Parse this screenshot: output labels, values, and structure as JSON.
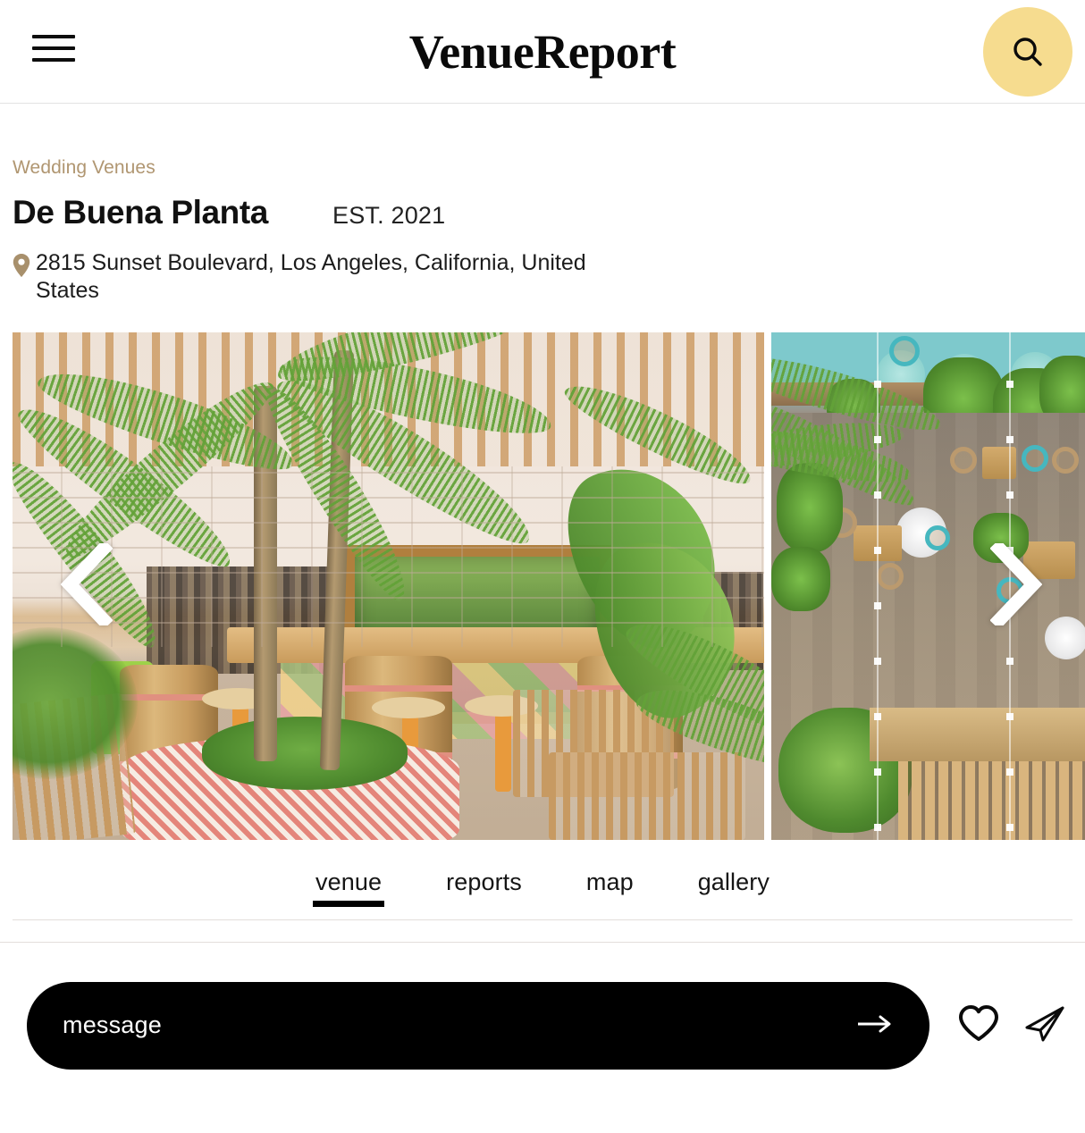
{
  "header": {
    "menu_icon": "hamburger-menu-icon",
    "brand": "VenueReport",
    "search_icon": "search-icon",
    "search_bg_color": "#f6dc8f"
  },
  "venue": {
    "breadcrumb": "Wedding Venues",
    "breadcrumb_color": "#b09671",
    "name": "De Buena Planta",
    "established": "EST. 2021",
    "location_icon": "map-pin-icon",
    "address": "2815 Sunset Boulevard, Los Angeles, California, United States"
  },
  "gallery": {
    "prev_icon": "chevron-left-icon",
    "next_icon": "chevron-right-icon",
    "slides": [
      {
        "alt": "Outdoor tropical bar with palm trees, wooden barrels and stools"
      },
      {
        "alt": "Aerial view of patio with dining tables, planters and string lights"
      }
    ]
  },
  "tabs": {
    "active": "venue",
    "items": [
      {
        "label": "venue",
        "active": true
      },
      {
        "label": "reports",
        "active": false
      },
      {
        "label": "map",
        "active": false
      },
      {
        "label": "gallery",
        "active": false
      }
    ]
  },
  "actions": {
    "message_label": "message",
    "message_arrow_icon": "arrow-right-icon",
    "favorite_icon": "heart-outline-icon",
    "share_icon": "paper-plane-icon",
    "pill_bg_color": "#000000"
  }
}
